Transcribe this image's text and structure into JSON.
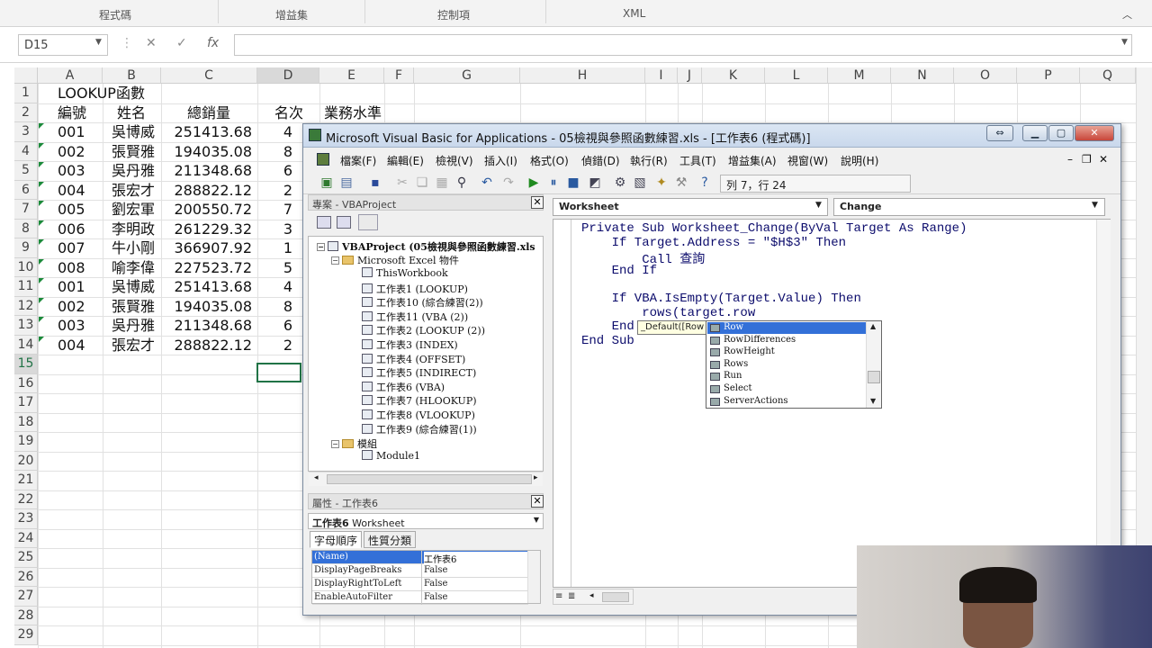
{
  "ribbon": {
    "groups": [
      "程式碼",
      "增益集",
      "控制項",
      "XML"
    ]
  },
  "formula_bar": {
    "name_box": "D15",
    "cancel": "✕",
    "enter": "✓",
    "fx": "fx",
    "value": ""
  },
  "sheet": {
    "columns": [
      "A",
      "B",
      "C",
      "D",
      "E",
      "F",
      "G",
      "H",
      "I",
      "J",
      "K",
      "L",
      "M",
      "N",
      "O",
      "P",
      "Q"
    ],
    "rows": [
      "1",
      "2",
      "3",
      "4",
      "5",
      "6",
      "7",
      "8",
      "9",
      "10",
      "11",
      "12",
      "13",
      "14",
      "15",
      "16",
      "17",
      "18",
      "19",
      "20",
      "21",
      "22",
      "23",
      "24",
      "25",
      "26",
      "27",
      "28",
      "29"
    ],
    "title": "LOOKUP函數",
    "headers": [
      "編號",
      "姓名",
      "總銷量",
      "名次",
      "業務水準"
    ],
    "data": [
      [
        "001",
        "吳博威",
        "251413.68",
        "4"
      ],
      [
        "002",
        "張賢雅",
        "194035.08",
        "8"
      ],
      [
        "003",
        "吳丹雅",
        "211348.68",
        "6"
      ],
      [
        "004",
        "張宏才",
        "288822.12",
        "2"
      ],
      [
        "005",
        "劉宏軍",
        "200550.72",
        "7"
      ],
      [
        "006",
        "李明政",
        "261229.32",
        "3"
      ],
      [
        "007",
        "牛小剛",
        "366907.92",
        "1"
      ],
      [
        "008",
        "喻李偉",
        "227523.72",
        "5"
      ],
      [
        "001",
        "吳博威",
        "251413.68",
        "4"
      ],
      [
        "002",
        "張賢雅",
        "194035.08",
        "8"
      ],
      [
        "003",
        "吳丹雅",
        "211348.68",
        "6"
      ],
      [
        "004",
        "張宏才",
        "288822.12",
        "2"
      ]
    ]
  },
  "vba": {
    "title": "Microsoft Visual Basic for Applications - 05檢視與參照函數練習.xls - [工作表6 (程式碼)]",
    "menu": [
      "檔案(F)",
      "編輯(E)",
      "檢視(V)",
      "插入(I)",
      "格式(O)",
      "偵錯(D)",
      "執行(R)",
      "工具(T)",
      "增益集(A)",
      "視窗(W)",
      "說明(H)"
    ],
    "cursor_pos": "列 7，行 24",
    "project_pane_title": "專案 - VBAProject",
    "tree": {
      "root": "VBAProject (05檢視與參照函數練習.xls",
      "excel_folder": "Microsoft Excel 物件",
      "items": [
        "ThisWorkbook",
        "工作表1 (LOOKUP)",
        "工作表10 (綜合練習(2))",
        "工作表11 (VBA (2))",
        "工作表2 (LOOKUP (2))",
        "工作表3 (INDEX)",
        "工作表4 (OFFSET)",
        "工作表5 (INDIRECT)",
        "工作表6 (VBA)",
        "工作表7 (HLOOKUP)",
        "工作表8 (VLOOKUP)",
        "工作表9 (綜合練習(1))"
      ],
      "modules_folder": "模組",
      "module": "Module1"
    },
    "properties": {
      "title": "屬性 - 工作表6",
      "object_name": "工作表6",
      "object_type": "Worksheet",
      "tabs": [
        "字母順序",
        "性質分類"
      ],
      "rows": [
        {
          "k": "(Name)",
          "v": "工作表6"
        },
        {
          "k": "DisplayPageBreaks",
          "v": "False"
        },
        {
          "k": "DisplayRightToLeft",
          "v": "False"
        },
        {
          "k": "EnableAutoFilter",
          "v": "False"
        }
      ]
    },
    "object_combo": "Worksheet",
    "proc_combo": "Change",
    "code": [
      "Private Sub Worksheet_Change(ByVal Target As Range)",
      "    If Target.Address = \"$H$3\" Then",
      "        Call 查詢",
      "    End If",
      "",
      "    If VBA.IsEmpty(Target.Value) Then",
      "        rows(target.row",
      "    End",
      "End Sub"
    ],
    "tooltip": "_Default([Row",
    "autocomplete": [
      "Row",
      "RowDifferences",
      "RowHeight",
      "Rows",
      "Run",
      "Select",
      "ServerActions"
    ]
  }
}
